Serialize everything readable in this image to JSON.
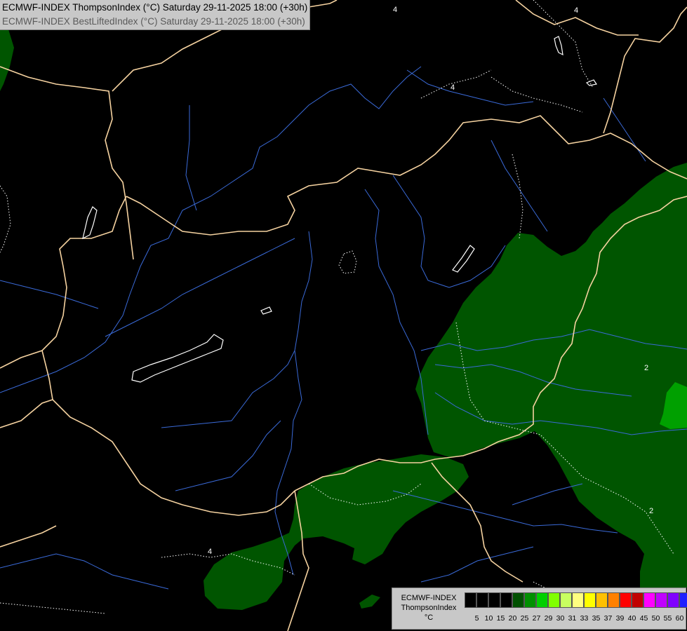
{
  "header": {
    "line1": "ECMWF-INDEX ThompsonIndex (°C) Saturday 29-11-2025 18:00 (+30h)",
    "line2": "ECMWF-INDEX BestLiftedIndex (°C) Saturday 29-11-2025 18:00 (+30h)"
  },
  "map": {
    "contour_labels": [
      "4",
      "4",
      "4",
      "2",
      "2",
      "4",
      "4"
    ]
  },
  "legend": {
    "title_line1": "ECMWF-INDEX",
    "title_line2": "ThompsonIndex",
    "title_line3": "°C",
    "levels": [
      "5",
      "10",
      "15",
      "20",
      "25",
      "27",
      "29",
      "30",
      "31",
      "33",
      "35",
      "37",
      "39",
      "40",
      "45",
      "50",
      "55",
      "60"
    ],
    "colors": [
      "#000000",
      "#000000",
      "#000000",
      "#000000",
      "#005000",
      "#009000",
      "#00d000",
      "#80ff00",
      "#c8ff60",
      "#ffff80",
      "#ffff00",
      "#ffc000",
      "#ff8000",
      "#ff0000",
      "#c00000",
      "#ff00ff",
      "#c000ff",
      "#8000ff",
      "#2020ff"
    ]
  }
}
